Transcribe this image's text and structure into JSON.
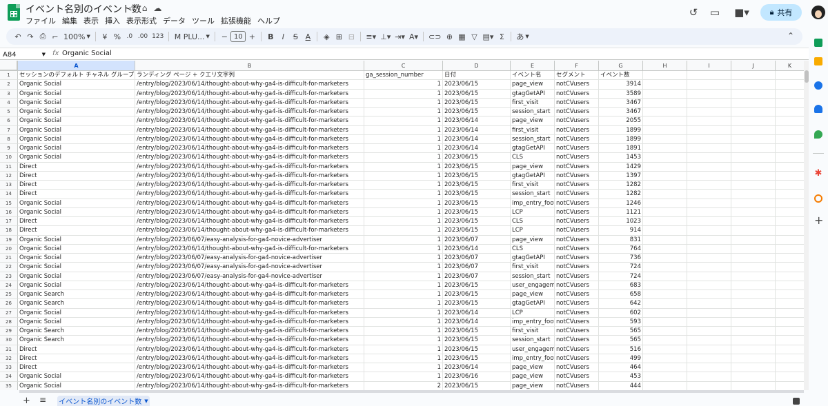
{
  "app": {
    "doc_title": "イベント名別のイベント数",
    "menu": [
      "ファイル",
      "編集",
      "表示",
      "挿入",
      "表示形式",
      "データ",
      "ツール",
      "拡張機能",
      "ヘルプ"
    ],
    "share_label": "共有"
  },
  "toolbar": {
    "zoom": "100%",
    "currency": "¥",
    "percent": "%",
    "dec_decrease": ".0",
    "dec_increase": ".00",
    "format_123": "123",
    "font": "M PLU...",
    "font_size": "10",
    "bold": "B",
    "italic": "I",
    "strikethrough": "S",
    "text_color": "A",
    "input_tools": "あ",
    "sigma": "Σ"
  },
  "formula_bar": {
    "name_box": "A84",
    "fx_label": "fx",
    "value": "Organic Social"
  },
  "columns": [
    "A",
    "B",
    "C",
    "D",
    "E",
    "F",
    "G",
    "H",
    "I",
    "J",
    "K"
  ],
  "header_row": [
    "セッションのデフォルト チャネル グループ",
    "ランディング ページ + クエリ文字列",
    "ga_session_number",
    "日付",
    "イベント名",
    "セグメント",
    "イベント数"
  ],
  "rows": [
    [
      "Organic Social",
      "/entry/blog/2023/06/14/thought-about-why-ga4-is-difficult-for-marketers",
      "1",
      "2023/06/15",
      "page_view",
      "notCVusers",
      "3914"
    ],
    [
      "Organic Social",
      "/entry/blog/2023/06/14/thought-about-why-ga4-is-difficult-for-marketers",
      "1",
      "2023/06/15",
      "gtagGetAPI",
      "notCVusers",
      "3589"
    ],
    [
      "Organic Social",
      "/entry/blog/2023/06/14/thought-about-why-ga4-is-difficult-for-marketers",
      "1",
      "2023/06/15",
      "first_visit",
      "notCVusers",
      "3467"
    ],
    [
      "Organic Social",
      "/entry/blog/2023/06/14/thought-about-why-ga4-is-difficult-for-marketers",
      "1",
      "2023/06/15",
      "session_start",
      "notCVusers",
      "3467"
    ],
    [
      "Organic Social",
      "/entry/blog/2023/06/14/thought-about-why-ga4-is-difficult-for-marketers",
      "1",
      "2023/06/14",
      "page_view",
      "notCVusers",
      "2055"
    ],
    [
      "Organic Social",
      "/entry/blog/2023/06/14/thought-about-why-ga4-is-difficult-for-marketers",
      "1",
      "2023/06/14",
      "first_visit",
      "notCVusers",
      "1899"
    ],
    [
      "Organic Social",
      "/entry/blog/2023/06/14/thought-about-why-ga4-is-difficult-for-marketers",
      "1",
      "2023/06/14",
      "session_start",
      "notCVusers",
      "1899"
    ],
    [
      "Organic Social",
      "/entry/blog/2023/06/14/thought-about-why-ga4-is-difficult-for-marketers",
      "1",
      "2023/06/14",
      "gtagGetAPI",
      "notCVusers",
      "1891"
    ],
    [
      "Organic Social",
      "/entry/blog/2023/06/14/thought-about-why-ga4-is-difficult-for-marketers",
      "1",
      "2023/06/15",
      "CLS",
      "notCVusers",
      "1453"
    ],
    [
      "Direct",
      "/entry/blog/2023/06/14/thought-about-why-ga4-is-difficult-for-marketers",
      "1",
      "2023/06/15",
      "page_view",
      "notCVusers",
      "1429"
    ],
    [
      "Direct",
      "/entry/blog/2023/06/14/thought-about-why-ga4-is-difficult-for-marketers",
      "1",
      "2023/06/15",
      "gtagGetAPI",
      "notCVusers",
      "1397"
    ],
    [
      "Direct",
      "/entry/blog/2023/06/14/thought-about-why-ga4-is-difficult-for-marketers",
      "1",
      "2023/06/15",
      "first_visit",
      "notCVusers",
      "1282"
    ],
    [
      "Direct",
      "/entry/blog/2023/06/14/thought-about-why-ga4-is-difficult-for-marketers",
      "1",
      "2023/06/15",
      "session_start",
      "notCVusers",
      "1282"
    ],
    [
      "Organic Social",
      "/entry/blog/2023/06/14/thought-about-why-ga4-is-difficult-for-marketers",
      "1",
      "2023/06/15",
      "imp_entry_foote",
      "notCVusers",
      "1246"
    ],
    [
      "Organic Social",
      "/entry/blog/2023/06/14/thought-about-why-ga4-is-difficult-for-marketers",
      "1",
      "2023/06/15",
      "LCP",
      "notCVusers",
      "1121"
    ],
    [
      "Direct",
      "/entry/blog/2023/06/14/thought-about-why-ga4-is-difficult-for-marketers",
      "1",
      "2023/06/15",
      "CLS",
      "notCVusers",
      "1023"
    ],
    [
      "Direct",
      "/entry/blog/2023/06/14/thought-about-why-ga4-is-difficult-for-marketers",
      "1",
      "2023/06/15",
      "LCP",
      "notCVusers",
      "914"
    ],
    [
      "Organic Social",
      "/entry/blog/2023/06/07/easy-analysis-for-ga4-novice-advertiser",
      "1",
      "2023/06/07",
      "page_view",
      "notCVusers",
      "831"
    ],
    [
      "Organic Social",
      "/entry/blog/2023/06/14/thought-about-why-ga4-is-difficult-for-marketers",
      "1",
      "2023/06/14",
      "CLS",
      "notCVusers",
      "764"
    ],
    [
      "Organic Social",
      "/entry/blog/2023/06/07/easy-analysis-for-ga4-novice-advertiser",
      "1",
      "2023/06/07",
      "gtagGetAPI",
      "notCVusers",
      "736"
    ],
    [
      "Organic Social",
      "/entry/blog/2023/06/07/easy-analysis-for-ga4-novice-advertiser",
      "1",
      "2023/06/07",
      "first_visit",
      "notCVusers",
      "724"
    ],
    [
      "Organic Social",
      "/entry/blog/2023/06/07/easy-analysis-for-ga4-novice-advertiser",
      "1",
      "2023/06/07",
      "session_start",
      "notCVusers",
      "724"
    ],
    [
      "Organic Social",
      "/entry/blog/2023/06/14/thought-about-why-ga4-is-difficult-for-marketers",
      "1",
      "2023/06/15",
      "user_engagemen",
      "notCVusers",
      "683"
    ],
    [
      "Organic Search",
      "/entry/blog/2023/06/14/thought-about-why-ga4-is-difficult-for-marketers",
      "1",
      "2023/06/15",
      "page_view",
      "notCVusers",
      "658"
    ],
    [
      "Organic Search",
      "/entry/blog/2023/06/14/thought-about-why-ga4-is-difficult-for-marketers",
      "1",
      "2023/06/15",
      "gtagGetAPI",
      "notCVusers",
      "642"
    ],
    [
      "Organic Social",
      "/entry/blog/2023/06/14/thought-about-why-ga4-is-difficult-for-marketers",
      "1",
      "2023/06/14",
      "LCP",
      "notCVusers",
      "602"
    ],
    [
      "Organic Social",
      "/entry/blog/2023/06/14/thought-about-why-ga4-is-difficult-for-marketers",
      "1",
      "2023/06/14",
      "imp_entry_foote",
      "notCVusers",
      "593"
    ],
    [
      "Organic Search",
      "/entry/blog/2023/06/14/thought-about-why-ga4-is-difficult-for-marketers",
      "1",
      "2023/06/15",
      "first_visit",
      "notCVusers",
      "565"
    ],
    [
      "Organic Search",
      "/entry/blog/2023/06/14/thought-about-why-ga4-is-difficult-for-marketers",
      "1",
      "2023/06/15",
      "session_start",
      "notCVusers",
      "565"
    ],
    [
      "Direct",
      "/entry/blog/2023/06/14/thought-about-why-ga4-is-difficult-for-marketers",
      "1",
      "2023/06/15",
      "user_engagemen",
      "notCVusers",
      "516"
    ],
    [
      "Direct",
      "/entry/blog/2023/06/14/thought-about-why-ga4-is-difficult-for-marketers",
      "1",
      "2023/06/15",
      "imp_entry_foote",
      "notCVusers",
      "499"
    ],
    [
      "Direct",
      "/entry/blog/2023/06/14/thought-about-why-ga4-is-difficult-for-marketers",
      "1",
      "2023/06/14",
      "page_view",
      "notCVusers",
      "464"
    ],
    [
      "Organic Social",
      "/entry/blog/2023/06/14/thought-about-why-ga4-is-difficult-for-marketers",
      "1",
      "2023/06/16",
      "page_view",
      "notCVusers",
      "453"
    ],
    [
      "Organic Social",
      "/entry/blog/2023/06/14/thought-about-why-ga4-is-difficult-for-marketers",
      "2",
      "2023/06/15",
      "page_view",
      "notCVusers",
      "444"
    ]
  ],
  "bottom": {
    "sheet_tab": "イベント名別のイベント数"
  },
  "colors": {
    "accent": "#0b57d0",
    "share_bg": "#c2e7ff",
    "toolbar_bg": "#edf2fa",
    "logo_green": "#0f9d58"
  }
}
